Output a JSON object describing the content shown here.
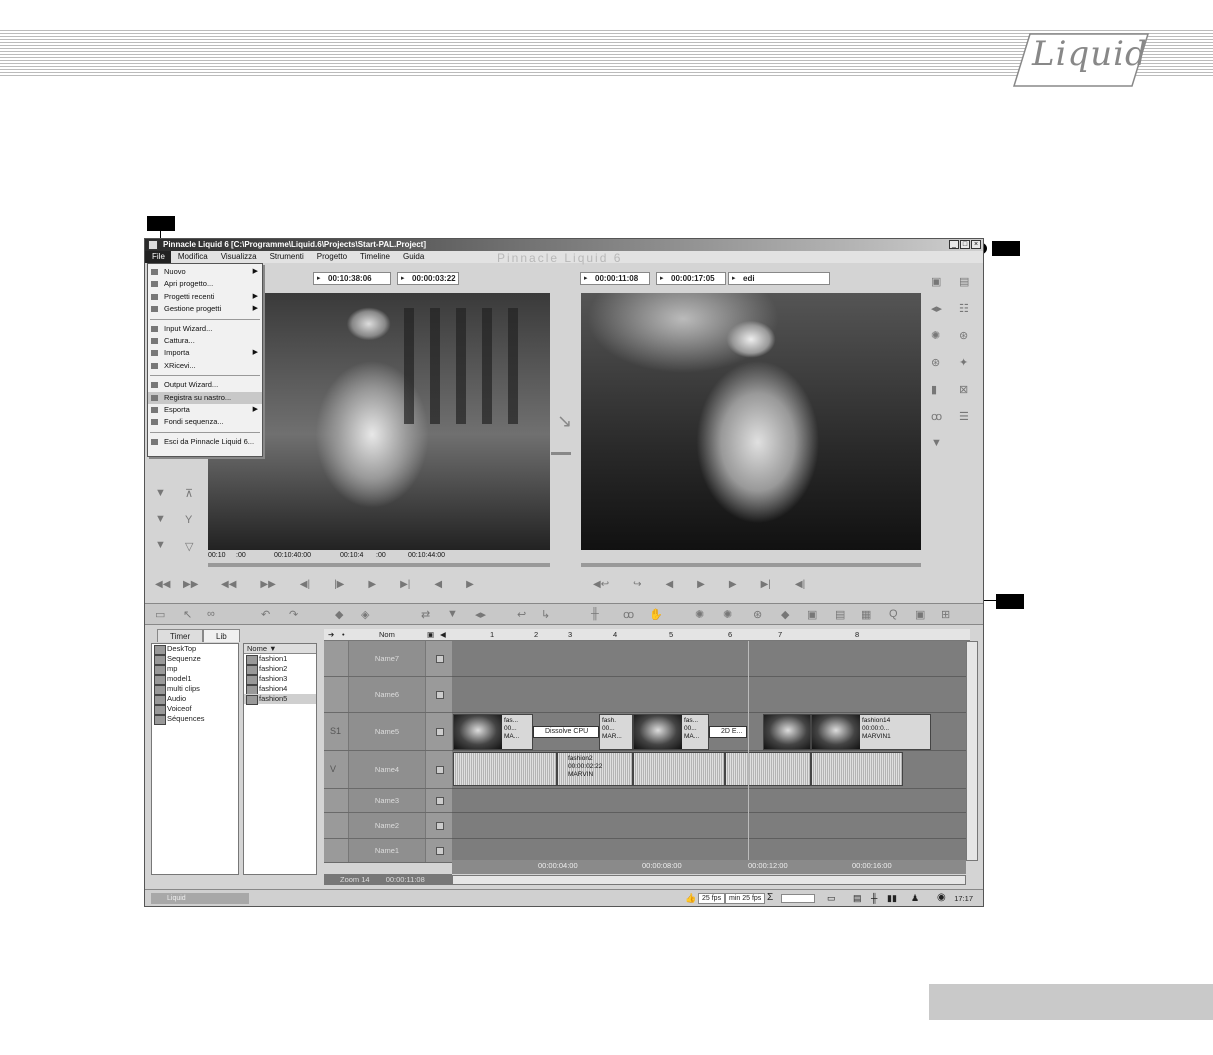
{
  "app": {
    "title": "Pinnacle Liquid 6 [C:\\Programme\\Liquid.6\\Projects\\Start-PAL.Project]",
    "watermark": "Pinnacle Liquid 6",
    "logo": "Liquid"
  },
  "menubar": [
    "File",
    "Modifica",
    "Visualizza",
    "Strumenti",
    "Progetto",
    "Timeline",
    "Guida"
  ],
  "file_menu": [
    {
      "label": "Nuovo",
      "submenu": true
    },
    {
      "label": "Apri progetto..."
    },
    {
      "label": "Progetti recenti",
      "submenu": true
    },
    {
      "label": "Gestione progetti",
      "submenu": true
    },
    {
      "sep": true
    },
    {
      "label": "Input Wizard..."
    },
    {
      "label": "Cattura..."
    },
    {
      "label": "Importa",
      "submenu": true
    },
    {
      "label": "XRicevi..."
    },
    {
      "sep": true
    },
    {
      "label": "Output Wizard..."
    },
    {
      "label": "Registra su nastro...",
      "highlight": true
    },
    {
      "label": "Esporta",
      "submenu": true
    },
    {
      "label": "Fondi sequenza..."
    },
    {
      "sep": true
    },
    {
      "label": "Esci da Pinnacle Liquid 6..."
    }
  ],
  "source_viewer": {
    "tc_in": "00:10:38:06",
    "tc_dur": "00:00:03:22",
    "ruler": [
      "00:10",
      ":00",
      "00:10:40:00",
      "00:10:4",
      ":00",
      "00:10:44:00"
    ]
  },
  "master_viewer": {
    "tc_in": "00:00:11:08",
    "tc_dur": "00:00:17:05",
    "sequence": "edi"
  },
  "rack": {
    "tabs": [
      "Timer",
      "Lib"
    ],
    "tree": [
      "DeskTop",
      "Sequenze",
      "mp",
      "model1",
      "multi clips",
      "Audio",
      "Voiceof",
      "Séquences"
    ],
    "list_header": "Nome ▼",
    "list": [
      "fashion1",
      "fashion2",
      "fashion3",
      "fashion4",
      "fashion5"
    ]
  },
  "timeline": {
    "header_name": "Nom",
    "markers": [
      "1",
      "2",
      "3",
      "4",
      "5",
      "6",
      "7",
      "8"
    ],
    "tracks": [
      {
        "label": "",
        "name": "Name7"
      },
      {
        "label": "",
        "name": "Name6"
      },
      {
        "label": "S1",
        "name": "Name5"
      },
      {
        "label": "V",
        "name": "Name4"
      },
      {
        "label": "",
        "name": "Name3"
      },
      {
        "label": "",
        "name": "Name2"
      },
      {
        "label": "",
        "name": "Name1"
      }
    ],
    "video_clips": [
      {
        "lines": [
          "fas...",
          "00...",
          "MA..."
        ]
      },
      {
        "lines": [
          "fash.",
          "00...",
          "MAR..."
        ]
      },
      {
        "lines": [
          "fas...",
          "00...",
          "MA..."
        ]
      },
      {
        "lines": [
          "fashion14",
          "00:00:0...",
          "MARVIN1"
        ]
      }
    ],
    "transitions": [
      "Dissolve CPU",
      "2D E..."
    ],
    "audio_clips": [
      {
        "lines": [
          "fashion2",
          "00:00:02:22",
          "MARVIN"
        ]
      }
    ],
    "time_ruler": [
      "00:00:04:00",
      "00:00:08:00",
      "00:00:12:00",
      "00:00:16:00"
    ],
    "zoom": "Zoom 14",
    "zoom_tc": "00:00:11:08"
  },
  "statusbar": {
    "left": "Liquid",
    "fps": "25 fps",
    "fps_min": "min 25 fps",
    "clock": "17:17"
  }
}
